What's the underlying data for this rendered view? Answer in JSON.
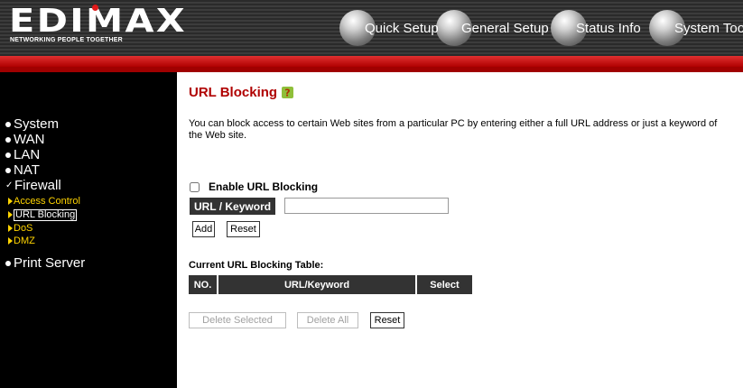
{
  "header": {
    "logo_text": "EDIMAX",
    "logo_tagline": "NETWORKING PEOPLE TOGETHER",
    "nav": [
      {
        "label": "Quick Setup",
        "icon": "globe-icon"
      },
      {
        "label": "General Setup",
        "icon": "globe-icon"
      },
      {
        "label": "Status Info",
        "icon": "globe-icon"
      },
      {
        "label": "System Tools",
        "icon": "globe-icon"
      }
    ]
  },
  "sidebar": {
    "items": [
      {
        "label": "System"
      },
      {
        "label": "WAN"
      },
      {
        "label": "LAN"
      },
      {
        "label": "NAT"
      },
      {
        "label": "Firewall"
      },
      {
        "label": "Print Server"
      }
    ],
    "sub_items": [
      {
        "label": "Access Control"
      },
      {
        "label": "URL Blocking"
      },
      {
        "label": "DoS"
      },
      {
        "label": "DMZ"
      }
    ]
  },
  "main": {
    "title": "URL Blocking",
    "description": "You can block access to certain Web sites from a particular PC by entering either a full URL address or just a keyword of the Web site.",
    "enable_label": "Enable URL Blocking",
    "keyword_label": "URL / Keyword",
    "keyword_value": "",
    "add_label": "Add",
    "reset_label": "Reset",
    "table_title": "Current URL Blocking Table:",
    "table_headers": [
      "NO.",
      "URL/Keyword",
      "Select"
    ],
    "delete_selected_label": "Delete Selected",
    "delete_all_label": "Delete All",
    "reset2_label": "Reset"
  },
  "colors": {
    "accent_red": "#b00000",
    "header_bg": "#333333",
    "submenu_yellow": "#ffd400"
  }
}
